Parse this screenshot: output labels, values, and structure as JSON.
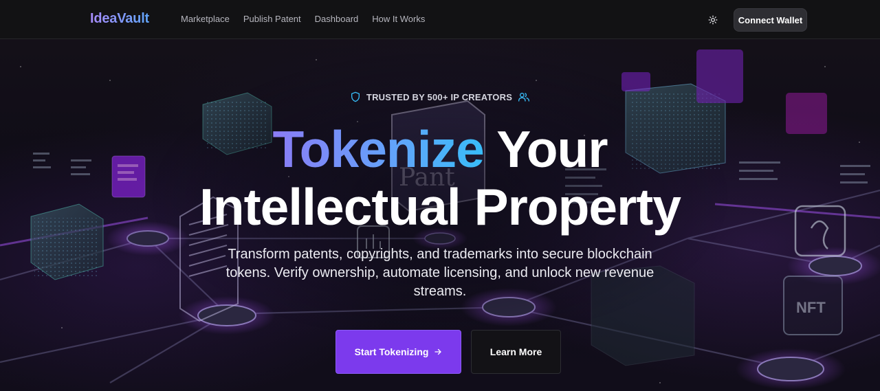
{
  "header": {
    "logo": "IdeaVault",
    "nav": [
      {
        "label": "Marketplace"
      },
      {
        "label": "Publish Patent"
      },
      {
        "label": "Dashboard"
      },
      {
        "label": "How It Works"
      }
    ],
    "theme_icon": "sun-icon",
    "connect_label": "Connect Wallet"
  },
  "hero": {
    "badge_text": "TRUSTED BY 500+ IP CREATORS",
    "badge_icons": [
      "shield-icon",
      "users-icon"
    ],
    "title_accent": "Tokenize",
    "title_rest": " Your",
    "title_line2": "Intellectual Property",
    "subtitle": "Transform patents, copyrights, and trademarks into secure blockchain tokens. Verify ownership, automate licensing, and unlock new revenue streams.",
    "primary_cta": "Start Tokenizing",
    "primary_cta_icon": "arrow-right-icon",
    "secondary_cta": "Learn More",
    "bg_text_pant": "Pant",
    "bg_text_nft": "NFT"
  },
  "colors": {
    "accent": "#7c3aed",
    "logo_gradient_start": "#a78bfa",
    "logo_gradient_end": "#60a5fa",
    "badge_icon": "#38bdf8",
    "header_bg": "#121214"
  }
}
